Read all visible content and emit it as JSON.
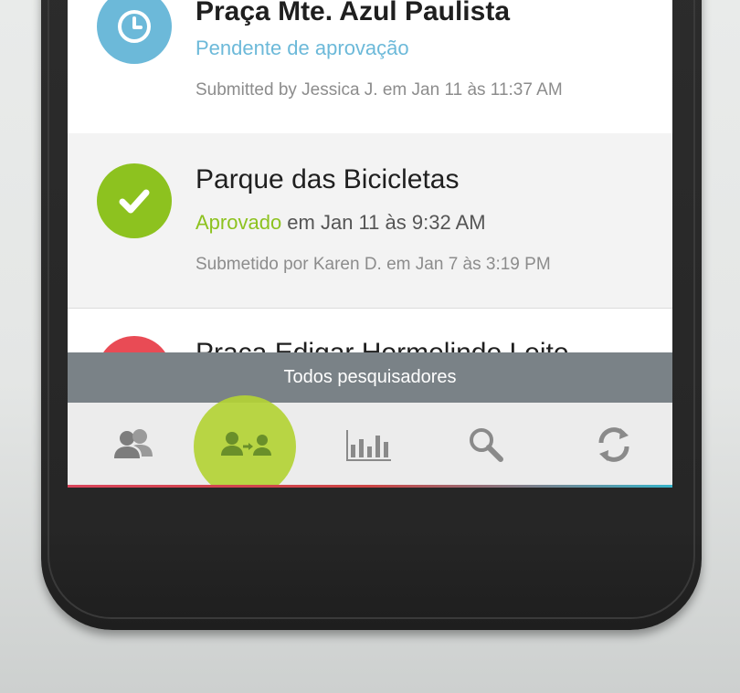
{
  "colors": {
    "pending": "#6cb9d9",
    "approved": "#8dc21f",
    "rejected": "#e94b55",
    "banner_bg": "#7a8287",
    "ripple": "#b3d235"
  },
  "cards": [
    {
      "title": "Praça Mte. Azul Paulista",
      "status": "Pendente de aprovação",
      "status_suffix": "",
      "meta": "Submitted by Jessica J. em Jan 11 às 11:37 AM",
      "icon": "clock-icon"
    },
    {
      "title": "Parque das Bicicletas",
      "status": "Aprovado",
      "status_suffix": " em Jan 11 às 9:32 AM",
      "meta": "Submetido por Karen D. em Jan 7 às 3:19 PM",
      "icon": "check-icon"
    },
    {
      "title": "Praça Edigar Hermelindo Leite",
      "icon": "rejected-icon"
    }
  ],
  "banner": {
    "text": "Todos pesquisadores"
  },
  "nav": {
    "items": [
      {
        "icon": "users-icon"
      },
      {
        "icon": "assign-users-icon",
        "active": true
      },
      {
        "icon": "bar-chart-icon"
      },
      {
        "icon": "search-icon"
      },
      {
        "icon": "refresh-icon"
      }
    ]
  }
}
